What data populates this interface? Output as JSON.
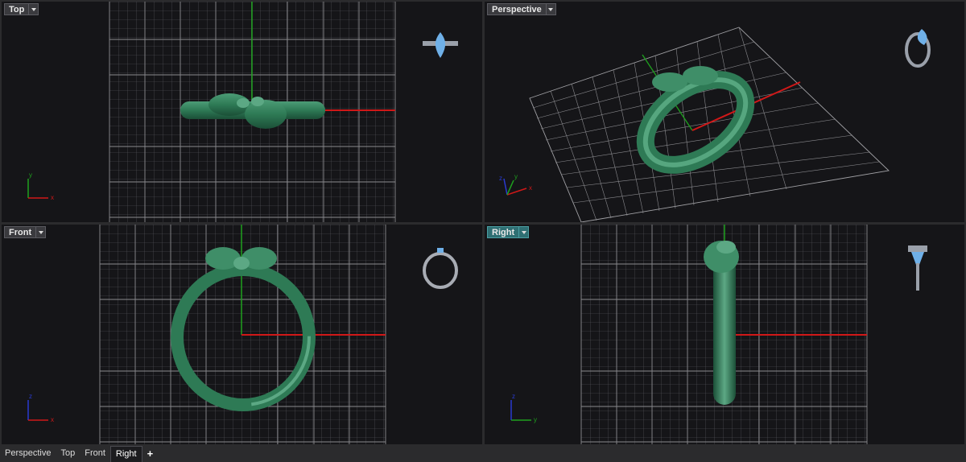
{
  "viewports": {
    "top": {
      "label": "Top",
      "axis_x": "x",
      "axis_y": "y"
    },
    "perspective": {
      "label": "Perspective",
      "axis_x": "x",
      "axis_y": "y",
      "axis_z": "z"
    },
    "front": {
      "label": "Front",
      "axis_x": "x",
      "axis_z": "z"
    },
    "right": {
      "label": "Right",
      "axis_y": "y",
      "axis_z": "z"
    }
  },
  "tabs": [
    "Perspective",
    "Top",
    "Front",
    "Right"
  ],
  "active_tab": "Right",
  "add_tab_label": "+",
  "colors": {
    "viewport_bg": "#151518",
    "grid": "#7a7a7a",
    "x_axis": "#d01818",
    "y_axis": "#1ea11e",
    "z_axis": "#2a3ad0",
    "model": "#2e7a55",
    "active_label": "#2f6f73"
  }
}
